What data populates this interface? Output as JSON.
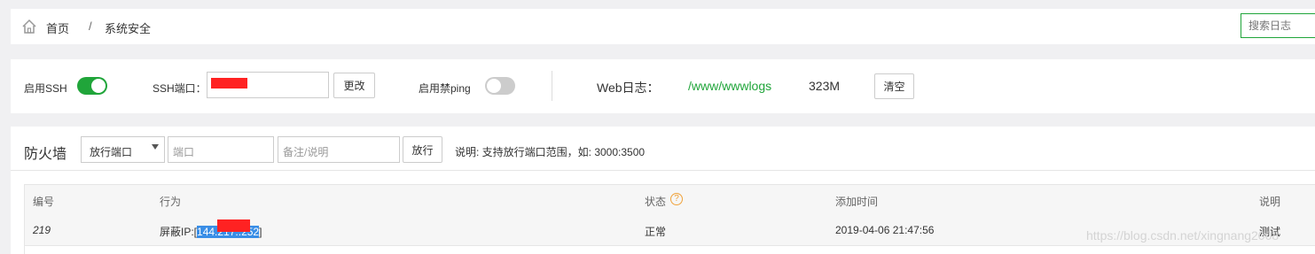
{
  "breadcrumb": {
    "home": "首页",
    "separator": "/",
    "current": "系统安全",
    "search_placeholder": "搜索日志"
  },
  "settings": {
    "ssh_label": "启用SSH",
    "ssh_enabled": true,
    "ssh_port_label": "SSH端口：",
    "ssh_port_value": "",
    "change_button": "更改",
    "ping_label": "启用禁ping",
    "ping_enabled": false,
    "web_log_label": "Web日志：",
    "web_log_path": "/www/wwwlogs",
    "web_log_size": "323M",
    "clear_button": "清空"
  },
  "firewall": {
    "title": "防火墙",
    "type_select": "放行端口",
    "port_placeholder": "端口",
    "note_placeholder": "备注/说明",
    "allow_button": "放行",
    "hint": "说明: 支持放行端口范围，如: 3000:3500",
    "columns": [
      "编号",
      "行为",
      "状态",
      "添加时间",
      "说明"
    ],
    "rows": [
      {
        "id": "219",
        "action_prefix": "屏蔽IP:[",
        "ip_start": "144.",
        "ip_mid": "217.",
        "ip_end": ".252",
        "action_suffix": "]",
        "status": "正常",
        "added": "2019-04-06 21:47:56",
        "note": "测试"
      }
    ]
  },
  "watermark": "https://blog.csdn.net/xingnang2008",
  "colors": {
    "accent_green": "#20a53a",
    "highlight_blue": "#3a8ee6",
    "redaction_red": "#ff2222",
    "help_orange": "#f0a23a"
  }
}
